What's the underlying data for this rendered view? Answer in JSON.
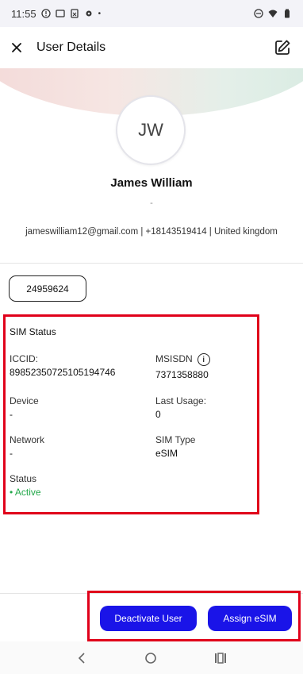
{
  "status_bar": {
    "time": "11:55"
  },
  "app_bar": {
    "title": "User Details"
  },
  "profile": {
    "initials": "JW",
    "name": "James William",
    "subtitle": "-",
    "contact": "jameswilliam12@gmail.com | +18143519414 | United kingdom"
  },
  "id_chip": "24959624",
  "sim_status": {
    "title": "SIM Status",
    "iccid_label": "ICCID:",
    "iccid_value": "89852350725105194746",
    "msisdn_label": "MSISDN",
    "msisdn_value": "7371358880",
    "device_label": "Device",
    "device_value": "-",
    "last_usage_label": "Last Usage:",
    "last_usage_value": "0",
    "network_label": "Network",
    "network_value": "-",
    "sim_type_label": "SIM Type",
    "sim_type_value": "eSIM",
    "status_label": "Status",
    "status_value": "Active"
  },
  "actions": {
    "deactivate_label": "Deactivate User",
    "assign_label": "Assign eSIM"
  },
  "colors": {
    "primary": "#1a14e8",
    "active": "#22a84a",
    "highlight": "#e0001a"
  }
}
